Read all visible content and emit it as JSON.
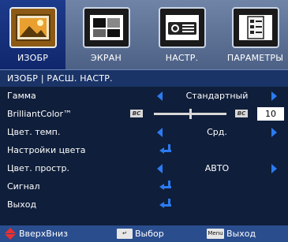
{
  "tabs": [
    {
      "label": "ИЗОБР",
      "icon": "picture-icon",
      "active": true
    },
    {
      "label": "ЭКРАН",
      "icon": "screen-icon",
      "active": false
    },
    {
      "label": "НАСТР.",
      "icon": "projector-settings-icon",
      "active": false
    },
    {
      "label": "ПАРАМЕТРЫ",
      "icon": "options-document-icon",
      "active": false
    }
  ],
  "breadcrumb": "ИЗОБР | РАСШ. НАСТР.",
  "rows": {
    "gamma": {
      "label": "Гамма",
      "value": "Стандартный"
    },
    "brilliant": {
      "label": "BrilliantColor™",
      "value": "10",
      "level": 0.5,
      "icon_text": "BC"
    },
    "color_temp": {
      "label": "Цвет. темп.",
      "value": "Срд."
    },
    "color_settings": {
      "label": "Настройки цвета"
    },
    "color_space": {
      "label": "Цвет. простр.",
      "value": "АВТО"
    },
    "signal": {
      "label": "Сигнал"
    },
    "exit": {
      "label": "Выход"
    }
  },
  "footer": {
    "updown_label": "ВверхВниз",
    "enter_label": "Выбор",
    "menu_key": "Menu",
    "menu_label": "Выход"
  },
  "colors": {
    "accent": "#2b7bf0",
    "active_tab": "#1d3b8c",
    "background": "#0f1e3a"
  }
}
